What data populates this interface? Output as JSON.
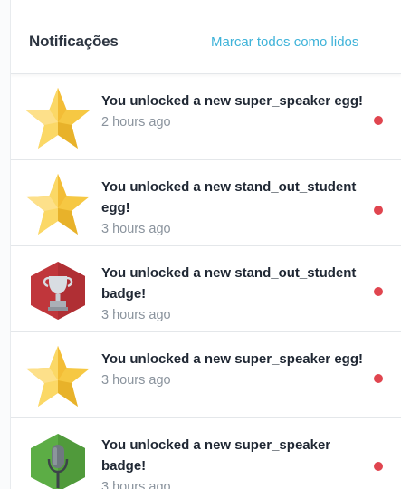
{
  "header": {
    "title": "Notificações",
    "mark_all_label": "Marcar todos como lidos"
  },
  "notifications": [
    {
      "title": "You unlocked a new super_speaker egg!",
      "time": "2 hours ago",
      "icon": "star-icon",
      "unread": true
    },
    {
      "title": "You unlocked a new stand_out_student egg!",
      "time": "3 hours ago",
      "icon": "star-icon",
      "unread": true
    },
    {
      "title": "You unlocked a new stand_out_student badge!",
      "time": "3 hours ago",
      "icon": "trophy-badge-icon",
      "unread": true
    },
    {
      "title": "You unlocked a new super_speaker egg!",
      "time": "3 hours ago",
      "icon": "star-icon",
      "unread": true
    },
    {
      "title": "You unlocked a new super_speaker badge!",
      "time": "3 hours ago",
      "icon": "microphone-badge-icon",
      "unread": true
    }
  ],
  "colors": {
    "accent": "#3fb3d9",
    "unread_dot": "#e0454f",
    "star": "#f6c843",
    "trophy_badge_bg": "#c0363b",
    "microphone_badge_bg": "#5cad45"
  }
}
